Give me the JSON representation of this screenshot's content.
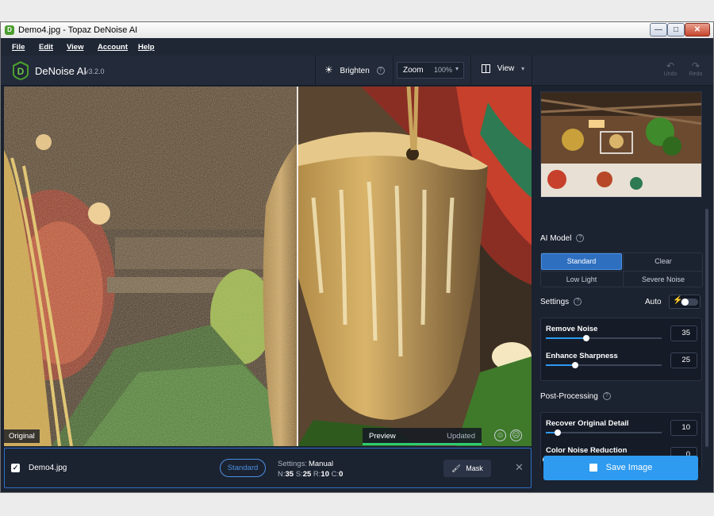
{
  "window": {
    "title": "Demo4.jpg - Topaz DeNoise AI"
  },
  "menu": [
    "File",
    "Edit",
    "View",
    "Account",
    "Help"
  ],
  "toolbar": {
    "app_name": "DeNoise AI",
    "version": "v3.2.0",
    "brighten": "Brighten",
    "zoom_label": "Zoom",
    "zoom_value": "100%",
    "view_label": "View",
    "undo": "Undo",
    "redo": "Redo"
  },
  "image": {
    "original_label": "Original",
    "preview_label": "Preview",
    "status": "Updated"
  },
  "panel": {
    "ai_model_title": "AI Model",
    "models": [
      "Standard",
      "Clear",
      "Low Light",
      "Severe Noise"
    ],
    "selected_model": "Standard",
    "settings_title": "Settings",
    "auto_label": "Auto",
    "auto_on": false,
    "sliders": [
      {
        "label": "Remove Noise",
        "value": 35
      },
      {
        "label": "Enhance Sharpness",
        "value": 25
      }
    ],
    "post_title": "Post-Processing",
    "post_sliders": [
      {
        "label": "Recover Original Detail",
        "value": 10
      },
      {
        "label": "Color Noise Reduction",
        "value": 0
      }
    ]
  },
  "bottom": {
    "filename": "Demo4.jpg",
    "checked": true,
    "model_pill": "Standard",
    "settings_label": "Settings:",
    "settings_mode": "Manual",
    "n_label": "N:",
    "n_value": "35",
    "s_label": "S:",
    "s_value": "25",
    "r_label": "R:",
    "r_value": "10",
    "c_label": "C:",
    "c_value": "0",
    "mask_label": "Mask",
    "save_label": "Save Image"
  },
  "colors": {
    "accent": "#2e9bf0",
    "brand_green": "#4a9d2e",
    "panel_bg": "#1b2230"
  }
}
